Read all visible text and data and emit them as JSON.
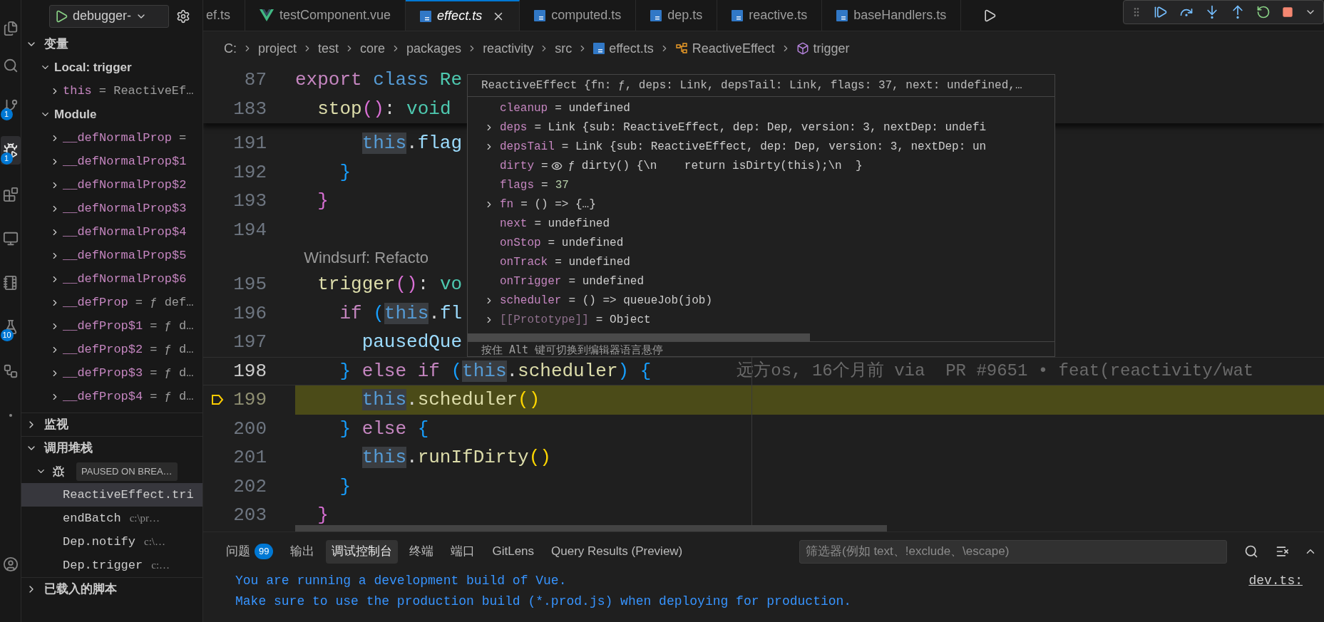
{
  "activity_bar": [
    {
      "kind": "explorer",
      "selected": false
    },
    {
      "kind": "search",
      "selected": false
    },
    {
      "kind": "source-control",
      "selected": false,
      "badge": "1"
    },
    {
      "kind": "run-debug",
      "selected": true,
      "badge": "1"
    },
    {
      "kind": "extensions",
      "selected": false
    },
    {
      "kind": "remote",
      "selected": false
    },
    {
      "kind": "notebook",
      "selected": false
    },
    {
      "kind": "testing",
      "selected": false,
      "badge": "10"
    },
    {
      "kind": "gitlens",
      "selected": false
    },
    {
      "kind": "more",
      "selected": false
    },
    {
      "kind": "account",
      "selected": false
    }
  ],
  "sidebar": {
    "launch_config": "debugger-",
    "variables": {
      "title": "变量",
      "expanded": true,
      "scopes": [
        {
          "label": "Local: trigger",
          "expanded": true,
          "items": [
            {
              "name": "this",
              "value": "= ReactiveEf…",
              "expanded": false
            }
          ]
        },
        {
          "label": "Module",
          "expanded": true,
          "items": [
            {
              "name": "__defNormalProp",
              "value": "=",
              "expanded": false
            },
            {
              "name": "__defNormalProp$1",
              "expanded": false
            },
            {
              "name": "__defNormalProp$2",
              "expanded": false
            },
            {
              "name": "__defNormalProp$3",
              "expanded": false
            },
            {
              "name": "__defNormalProp$4",
              "expanded": false
            },
            {
              "name": "__defNormalProp$5",
              "expanded": false
            },
            {
              "name": "__defNormalProp$6",
              "expanded": false
            },
            {
              "name": "__defProp",
              "value": "= ƒ def…",
              "expanded": false
            },
            {
              "name": "__defProp$1",
              "value": "= ƒ d…",
              "expanded": false
            },
            {
              "name": "__defProp$2",
              "value": "= ƒ d…",
              "expanded": false
            },
            {
              "name": "__defProp$3",
              "value": "= ƒ d…",
              "expanded": false
            },
            {
              "name": "__defProp$4",
              "value": "= ƒ d…",
              "expanded": false
            }
          ]
        }
      ]
    },
    "watch": {
      "title": "监视",
      "expanded": false
    },
    "call_stack": {
      "title": "调用堆栈",
      "expanded": true,
      "thread": {
        "state": "PAUSED ON BREA…",
        "expanded": true
      },
      "frames": [
        {
          "name": "ReactiveEffect.tri",
          "selected": true
        },
        {
          "name": "endBatch",
          "path": "c:\\pr…",
          "selected": false
        },
        {
          "name": "Dep.notify",
          "path": "c:\\…",
          "selected": false
        },
        {
          "name": "Dep.trigger",
          "path": "c:…",
          "selected": false
        }
      ]
    },
    "loaded_scripts": {
      "title": "已载入的脚本",
      "expanded": false
    }
  },
  "editor_tabs": [
    {
      "label": "ef.ts",
      "selected": false,
      "preview": false
    },
    {
      "label": "testComponent.vue",
      "kind": "vue",
      "selected": false,
      "preview": false
    },
    {
      "label": "effect.ts",
      "kind": "ts",
      "selected": true,
      "preview": true
    },
    {
      "label": "computed.ts",
      "kind": "ts",
      "selected": false,
      "preview": false
    },
    {
      "label": "dep.ts",
      "kind": "ts",
      "selected": false,
      "preview": false
    },
    {
      "label": "reactive.ts",
      "kind": "ts",
      "selected": false,
      "preview": false
    },
    {
      "label": "baseHandlers.ts",
      "kind": "ts",
      "selected": false,
      "preview": false
    }
  ],
  "breadcrumb": [
    {
      "label": "C:"
    },
    {
      "label": "project"
    },
    {
      "label": "test"
    },
    {
      "label": "core"
    },
    {
      "label": "packages"
    },
    {
      "label": "reactivity"
    },
    {
      "label": "src"
    },
    {
      "label": "effect.ts",
      "kind": "ts"
    },
    {
      "label": "ReactiveEffect",
      "kind": "class"
    },
    {
      "label": "trigger",
      "kind": "method"
    }
  ],
  "sticky_lines": [
    {
      "number": "87",
      "tokens": [
        {
          "text": "export ",
          "kind": "keyword"
        },
        {
          "text": "class ",
          "kind": "storage"
        },
        {
          "text": "Re",
          "kind": "type"
        }
      ],
      "children": [
        {
          "number": "183",
          "tokens": [
            {
              "text": "stop",
              "kind": "function"
            },
            {
              "text": "()",
              "kind": "bracket2"
            },
            {
              "text": ": ",
              "kind": "plain"
            },
            {
              "text": "void",
              "kind": "type"
            }
          ]
        }
      ]
    }
  ],
  "code_lines": [
    {
      "kind": "scrolled",
      "children": [
        {
          "kind": "scrolled",
          "children": [
            {
              "kind": "code",
              "number": "191",
              "current": false,
              "cursor": false,
              "tokens": [
                {
                  "text": "this",
                  "kind": "this"
                },
                {
                  "text": ".",
                  "kind": "plain"
                },
                {
                  "text": "flag",
                  "kind": "variable"
                }
              ]
            }
          ]
        },
        {
          "kind": "code",
          "number": "192",
          "current": false,
          "cursor": false,
          "tokens": [
            {
              "text": "}",
              "kind": "bracket3"
            }
          ]
        }
      ]
    },
    {
      "kind": "code",
      "number": "193",
      "current": false,
      "cursor": false,
      "tokens": [
        {
          "text": "}",
          "kind": "bracket2"
        }
      ]
    },
    {
      "kind": "code",
      "number": "194",
      "current": false,
      "cursor": false
    },
    {
      "kind": "codelens",
      "text": "Windsurf: Refacto"
    },
    {
      "kind": "code",
      "number": "195",
      "current": false,
      "cursor": false,
      "tokens": [
        {
          "text": "trigger",
          "kind": "function"
        },
        {
          "text": "()",
          "kind": "bracket2"
        },
        {
          "text": ": ",
          "kind": "plain"
        },
        {
          "text": "vo",
          "kind": "type"
        }
      ],
      "children": [
        {
          "kind": "code",
          "number": "196",
          "current": false,
          "cursor": false,
          "tokens": [
            {
              "text": "if ",
              "kind": "keyword"
            },
            {
              "text": "(",
              "kind": "bracket3"
            },
            {
              "text": "this",
              "kind": "this"
            },
            {
              "text": ".",
              "kind": "plain"
            },
            {
              "text": "fl",
              "kind": "variable"
            }
          ],
          "children": [
            {
              "kind": "code",
              "number": "197",
              "current": false,
              "cursor": false,
              "tokens": [
                {
                  "text": "pausedQue",
                  "kind": "variable"
                }
              ]
            }
          ]
        },
        {
          "kind": "code",
          "number": "198",
          "current": false,
          "cursor": true,
          "tokens": [
            {
              "text": "} ",
              "kind": "bracket3"
            },
            {
              "text": "else if ",
              "kind": "keyword"
            },
            {
              "text": "(",
              "kind": "bracket3"
            },
            {
              "text": "this",
              "kind": "this"
            },
            {
              "text": ".",
              "kind": "plain"
            },
            {
              "text": "scheduler",
              "kind": "function"
            },
            {
              "text": ") {",
              "kind": "bracket3"
            }
          ],
          "blame": "远方os, 16个月前 via  PR #9651 • feat(reactivity/wat",
          "children": [
            {
              "kind": "code",
              "number": "199",
              "current": true,
              "cursor": false,
              "tokens": [
                {
                  "text": "this",
                  "kind": "this"
                },
                {
                  "text": ".",
                  "kind": "plain"
                },
                {
                  "text": "scheduler",
                  "kind": "function"
                },
                {
                  "text": "()",
                  "kind": "bracket1"
                }
              ]
            }
          ]
        },
        {
          "kind": "code",
          "number": "200",
          "current": false,
          "cursor": false,
          "tokens": [
            {
              "text": "} ",
              "kind": "bracket3"
            },
            {
              "text": "else ",
              "kind": "keyword"
            },
            {
              "text": "{",
              "kind": "bracket3"
            }
          ],
          "children": [
            {
              "kind": "code",
              "number": "201",
              "current": false,
              "cursor": false,
              "tokens": [
                {
                  "text": "this",
                  "kind": "this"
                },
                {
                  "text": ".",
                  "kind": "plain"
                },
                {
                  "text": "runIfDirty",
                  "kind": "function"
                },
                {
                  "text": "()",
                  "kind": "bracket1"
                }
              ]
            }
          ]
        },
        {
          "kind": "code",
          "number": "202",
          "current": false,
          "cursor": false,
          "tokens": [
            {
              "text": "}",
              "kind": "bracket3"
            }
          ]
        }
      ]
    },
    {
      "kind": "code",
      "number": "203",
      "current": false,
      "cursor": false,
      "tokens": [
        {
          "text": "}",
          "kind": "bracket2"
        }
      ]
    }
  ],
  "hover": {
    "header": "ReactiveEffect {fn: ƒ, deps: Link, depsTail: Link, flags: 37, next: undefined,…",
    "rows": [
      {
        "name": "cleanup",
        "value": "= undefined",
        "kind": "plain",
        "expandable": false
      },
      {
        "name": "deps",
        "value": "= Link {sub: ReactiveEffect, dep: Dep, version: 3, nextDep: undefi",
        "kind": "plain",
        "expandable": true
      },
      {
        "name": "depsTail",
        "value": "= Link {sub: ReactiveEffect, dep: Dep, version: 3, nextDep: un",
        "kind": "plain",
        "expandable": true
      },
      {
        "name": "dirty",
        "value": "=",
        "getter": "ƒ dirty() {\\n    return isDirty(this);\\n  }",
        "kind": "getter",
        "expandable": false
      },
      {
        "name": "flags",
        "value": "=",
        "number": "37",
        "kind": "number",
        "expandable": false
      },
      {
        "name": "fn",
        "value": "= () => {…}",
        "kind": "plain",
        "expandable": true
      },
      {
        "name": "next",
        "value": "= undefined",
        "kind": "plain",
        "expandable": false
      },
      {
        "name": "onStop",
        "value": "= undefined",
        "kind": "plain",
        "expandable": false
      },
      {
        "name": "onTrack",
        "value": "= undefined",
        "kind": "plain",
        "expandable": false
      },
      {
        "name": "onTrigger",
        "value": "= undefined",
        "kind": "plain",
        "expandable": false
      },
      {
        "name": "scheduler",
        "value": "= () => queueJob(job)",
        "kind": "plain",
        "expandable": true
      },
      {
        "name": "[[Prototype]]",
        "value": "= Object",
        "kind": "internal",
        "expandable": true
      }
    ],
    "footer": "按住 Alt 键可切换到编辑器语言悬停"
  },
  "panel": {
    "tabs": [
      {
        "label": "问题",
        "badge": "99",
        "selected": false
      },
      {
        "label": "输出",
        "selected": false
      },
      {
        "label": "调试控制台",
        "selected": true
      },
      {
        "label": "终端",
        "selected": false
      },
      {
        "label": "端口",
        "selected": false
      },
      {
        "label": "GitLens",
        "selected": false
      },
      {
        "label": "Query Results (Preview)",
        "selected": false
      }
    ],
    "filter": {
      "placeholder": "筛选器(例如 text、!exclude、\\escape)"
    },
    "output": [
      {
        "text": "You are running a development build of Vue.",
        "source": "dev.ts:"
      },
      {
        "text": "Make sure to use the production build (*.prod.js) when deploying for production."
      }
    ]
  }
}
